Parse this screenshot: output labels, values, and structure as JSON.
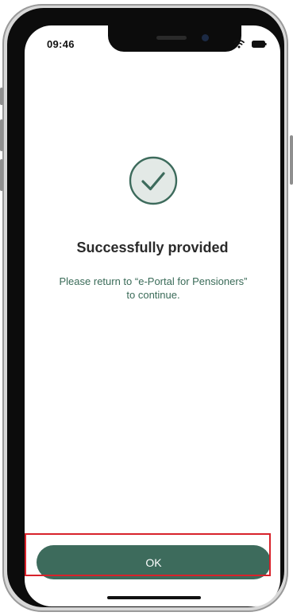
{
  "status_bar": {
    "time": "09:46",
    "wifi_icon": "wifi-icon",
    "battery_icon": "battery-icon"
  },
  "result": {
    "icon": "check-circle-icon",
    "title": "Successfully provided",
    "message": "Please return to “e-Portal for Pensioners” to continue."
  },
  "actions": {
    "ok_label": "OK",
    "highlighted": true
  },
  "colors": {
    "accent": "#3d6b5c",
    "message_text": "#3a6b58",
    "highlight_border": "#d8222b",
    "icon_fill": "#e3e9e6"
  }
}
